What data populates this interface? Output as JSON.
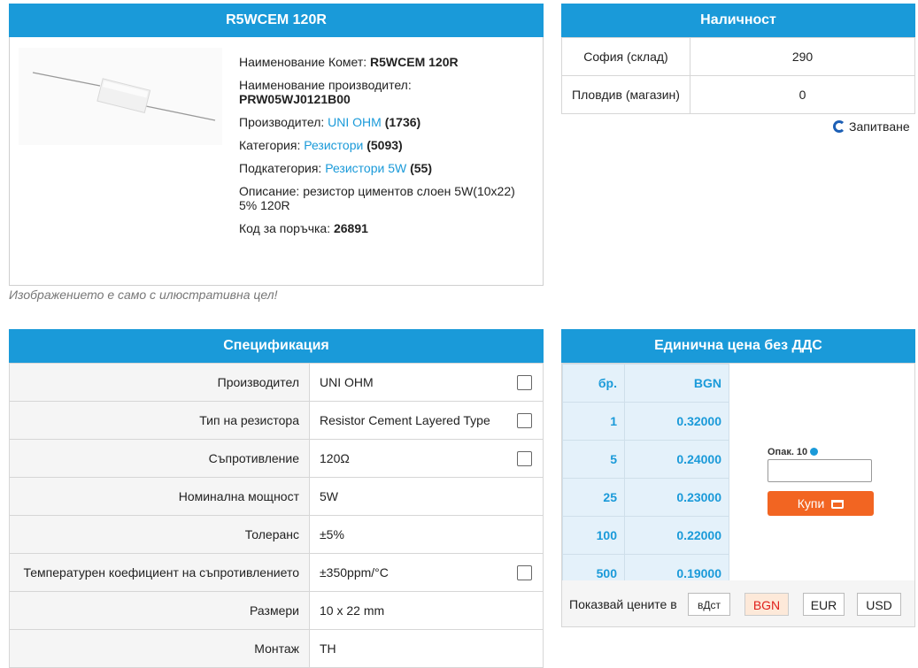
{
  "product": {
    "title": "R5WCEM 120R",
    "name_label": "Наименование Комет: ",
    "name_value": "R5WCEM 120R",
    "mfr_name_label": "Наименование производител:",
    "mfr_name_value": "PRW05WJ0121B00",
    "manufacturer_label": "Производител: ",
    "manufacturer_link": "UNI OHM",
    "manufacturer_count": "(1736)",
    "category_label": "Категория: ",
    "category_link": "Резистори",
    "category_count": "(5093)",
    "subcategory_label": "Подкатегория: ",
    "subcategory_link": "Резистори 5W",
    "subcategory_count": "(55)",
    "description_label": "Описание: ",
    "description_value": "резистор циментов слоен 5W(10x22) 5% 120R",
    "order_code_label": "Код за поръчка: ",
    "order_code_value": "26891",
    "image_note": "Изображението е само с илюстративна цел!"
  },
  "availability": {
    "title": "Наличност",
    "rows": [
      {
        "location": "София (склад)",
        "qty": "290"
      },
      {
        "location": "Пловдив (магазин)",
        "qty": "0"
      }
    ],
    "inquiry_label": "Запитване"
  },
  "spec": {
    "title": "Спецификация",
    "rows": [
      {
        "label": "Производител",
        "value": "UNI OHM"
      },
      {
        "label": "Тип на резистора",
        "value": "Resistor Cement Layered Type"
      },
      {
        "label": "Съпротивление",
        "value": "120Ω"
      },
      {
        "label": "Номинална мощност",
        "value": "5W"
      },
      {
        "label": "Толеранс",
        "value": "±5%"
      },
      {
        "label": "Температурен коефициент на съпротивлението",
        "value": "±350ppm/°C"
      },
      {
        "label": "Размери",
        "value": "10 x 22 mm"
      },
      {
        "label": "Монтаж",
        "value": "TH"
      }
    ]
  },
  "pricing": {
    "title": "Единична цена без ДДС",
    "qty_header": "бр.",
    "price_header": "BGN",
    "rows": [
      {
        "qty": "1",
        "price": "0.32000"
      },
      {
        "qty": "5",
        "price": "0.24000"
      },
      {
        "qty": "25",
        "price": "0.23000"
      },
      {
        "qty": "100",
        "price": "0.22000"
      },
      {
        "qty": "500",
        "price": "0.19000"
      }
    ],
    "pack_label": "Опак. 10",
    "buy_label": "Купи",
    "show_prices_label": "Показвай цените в",
    "currencies": [
      "вДст",
      "BGN",
      "EUR",
      "USD"
    ],
    "selected_currency": "BGN"
  },
  "colors": {
    "header_blue": "#1a9ad9",
    "buy_orange": "#f26522",
    "selected_currency_red": "#e0201b"
  }
}
